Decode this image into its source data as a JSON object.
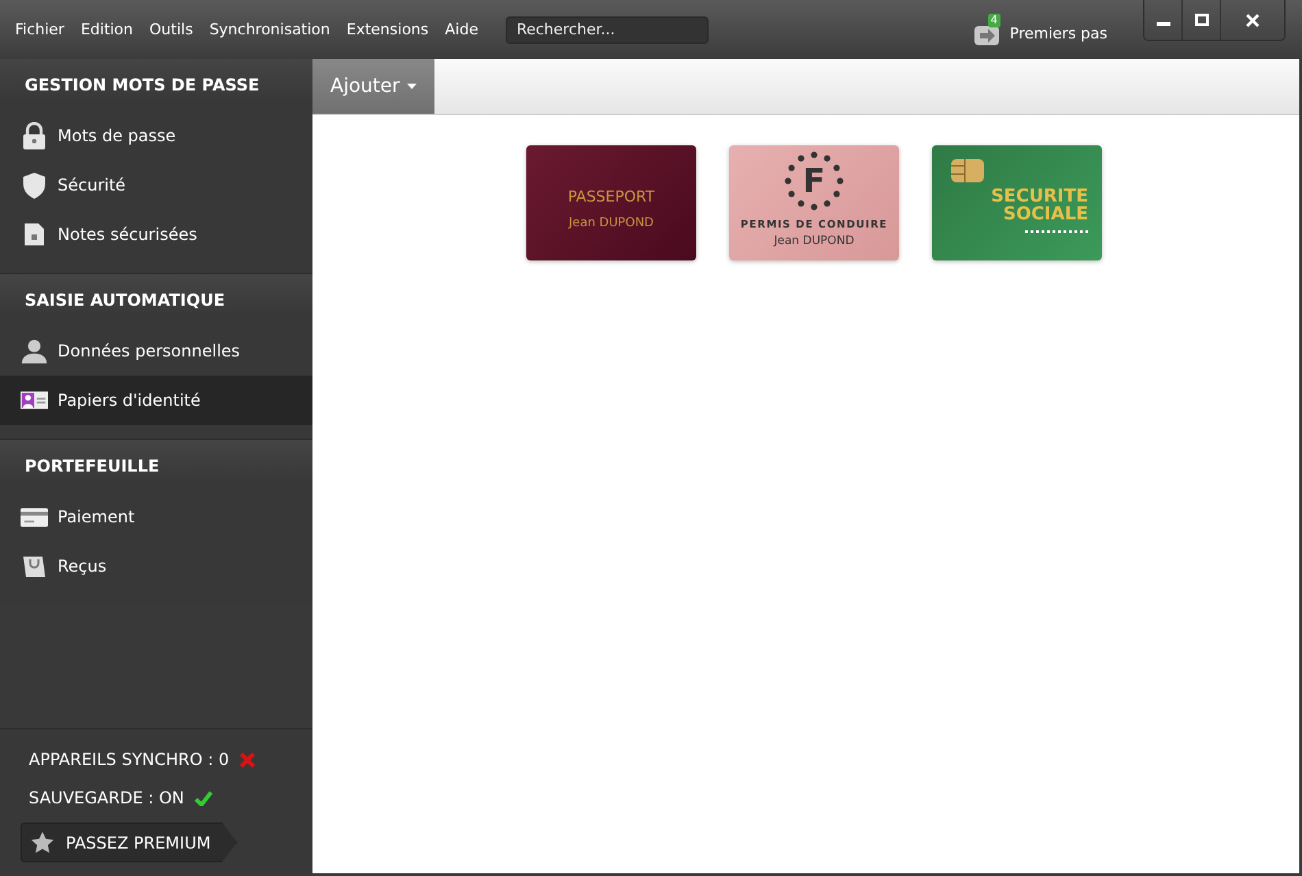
{
  "menu": [
    "Fichier",
    "Edition",
    "Outils",
    "Synchronisation",
    "Extensions",
    "Aide"
  ],
  "search": {
    "placeholder": "Rechercher..."
  },
  "getting_started": {
    "label": "Premiers pas",
    "badge": "4"
  },
  "sidebar": {
    "sections": [
      {
        "title": "GESTION MOTS DE PASSE",
        "items": [
          {
            "label": "Mots de passe",
            "kind": "lock",
            "selected": false
          },
          {
            "label": "Sécurité",
            "kind": "shield",
            "selected": false
          },
          {
            "label": "Notes sécurisées",
            "kind": "note",
            "selected": false
          }
        ]
      },
      {
        "title": "SAISIE AUTOMATIQUE",
        "items": [
          {
            "label": "Données personnelles",
            "kind": "person",
            "selected": false
          },
          {
            "label": "Papiers d'identité",
            "kind": "idcard",
            "selected": true
          }
        ]
      },
      {
        "title": "PORTEFEUILLE",
        "items": [
          {
            "label": "Paiement",
            "kind": "card",
            "selected": false
          },
          {
            "label": "Reçus",
            "kind": "bag",
            "selected": false
          }
        ]
      }
    ]
  },
  "status": [
    {
      "label": "APPAREILS SYNCHRO : 0",
      "ok": false
    },
    {
      "label": "SAUVEGARDE : ON",
      "ok": true
    }
  ],
  "premium_button": "PASSEZ PREMIUM",
  "toolbar": {
    "add_button": "Ajouter"
  },
  "cards": [
    {
      "kind": "passport",
      "title": "PASSEPORT",
      "holder": "Jean DUPOND"
    },
    {
      "kind": "license",
      "emblem": "F",
      "title": "PERMIS DE CONDUIRE",
      "holder": "Jean DUPOND"
    },
    {
      "kind": "social",
      "title_lines": [
        "SECURITE",
        "SOCIALE"
      ]
    }
  ]
}
